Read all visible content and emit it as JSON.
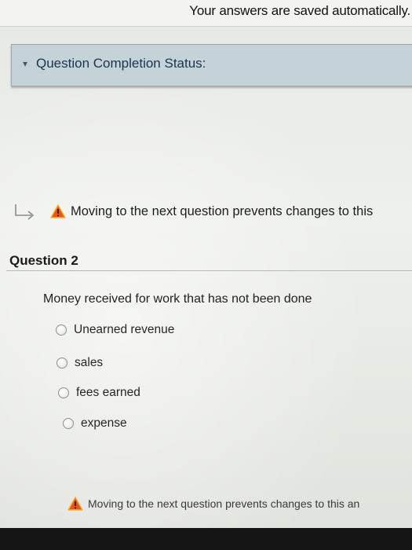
{
  "header": {
    "saved_note": "Your answers are saved automatically."
  },
  "completion": {
    "label": "Question Completion Status:",
    "chevron_icon": "chevron-down-icon"
  },
  "warning_top": {
    "text": "Moving to the next question prevents changes to this",
    "icon": "warning-icon",
    "arrow_icon": "next-arrow-icon"
  },
  "question": {
    "title": "Question 2",
    "prompt": "Money received for work that has not been done",
    "options": [
      {
        "label": "Unearned revenue",
        "selected": false
      },
      {
        "label": "sales",
        "selected": false
      },
      {
        "label": "fees earned",
        "selected": false
      },
      {
        "label": "expense",
        "selected": false
      }
    ]
  },
  "warning_bottom": {
    "text": "Moving to the next question prevents changes to this an",
    "icon": "warning-icon"
  },
  "colors": {
    "panel": "#c5d2d7",
    "warning_fill": "#e64a19",
    "warning_stroke": "#f1c232"
  }
}
